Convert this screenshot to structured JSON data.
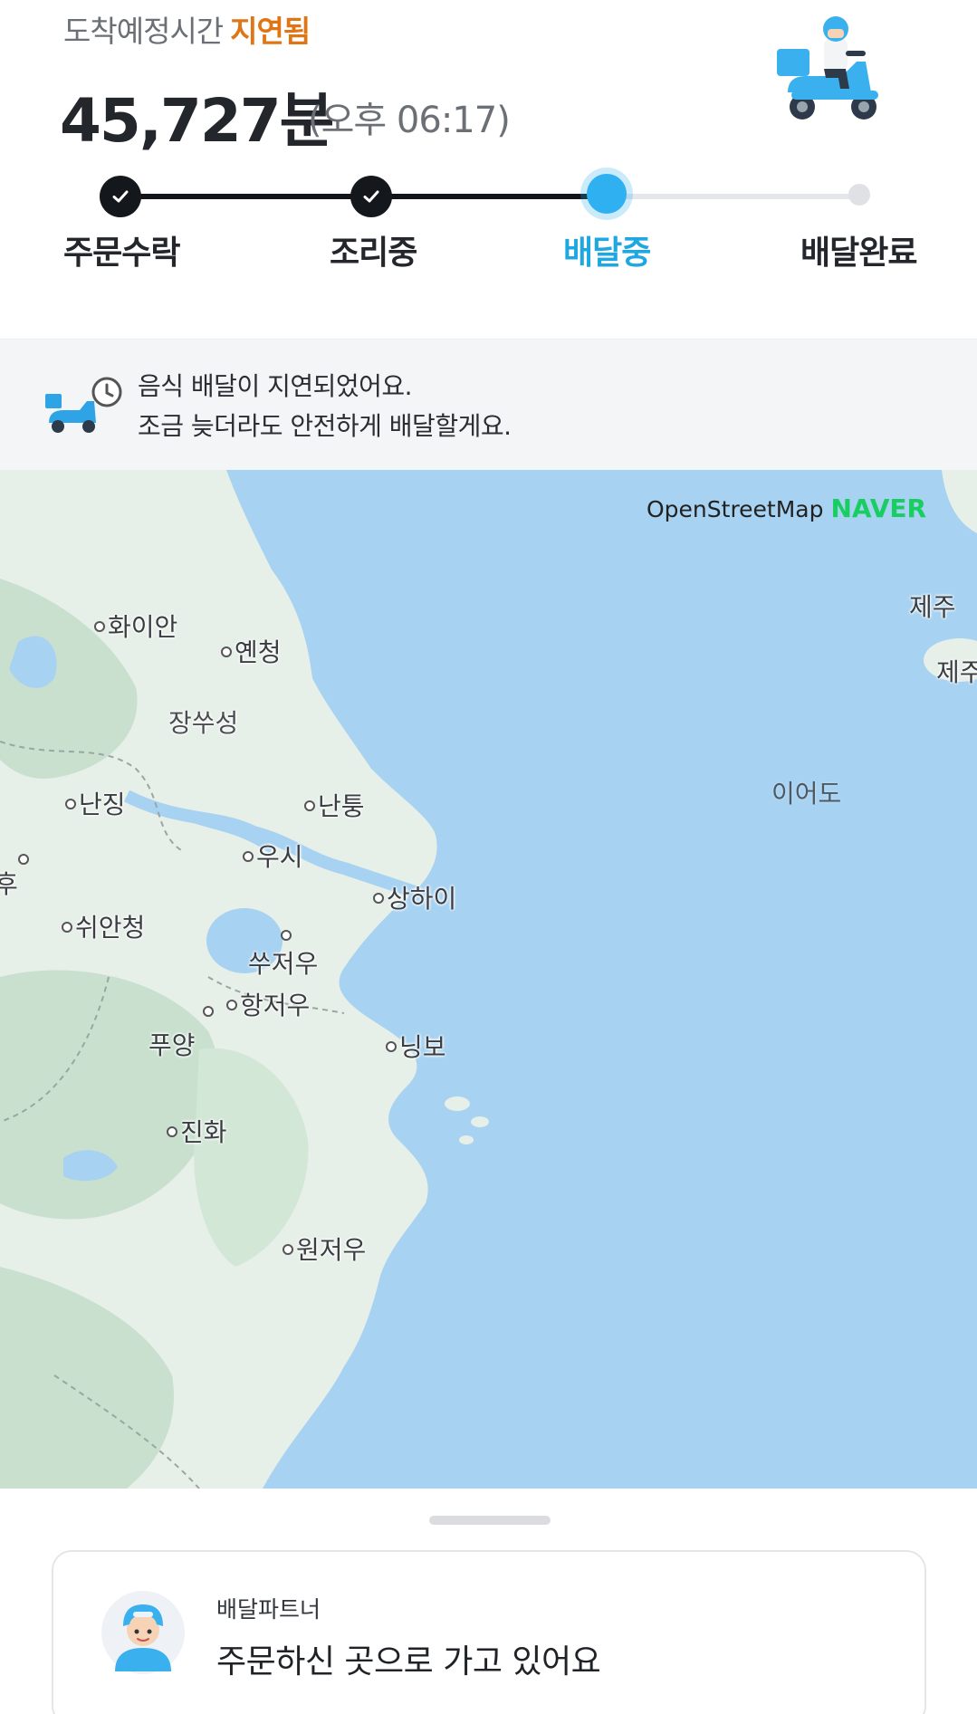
{
  "header": {
    "eta_label": "도착예정시간",
    "eta_status": "지연됨",
    "eta_minutes": "45,727분",
    "eta_clock": "(오후 06:17)",
    "rider_icon": "scooter-rider-illustration"
  },
  "progress": {
    "steps": [
      {
        "label": "주문수락",
        "state": "done"
      },
      {
        "label": "조리중",
        "state": "done"
      },
      {
        "label": "배달중",
        "state": "current"
      },
      {
        "label": "배달완료",
        "state": "pending"
      }
    ],
    "active_color": "#1ea7e0"
  },
  "notice": {
    "icon": "delivery-delay-icon",
    "line1": "음식 배달이 지연되었어요.",
    "line2": "조금 늦더라도 안전하게 배달할게요."
  },
  "map": {
    "attribution": "OpenStreetMap",
    "provider": "NAVER",
    "places": [
      "화이안",
      "옌청",
      "장쑤성",
      "난징",
      "난퉁",
      "우시",
      "쑤저우",
      "상하이",
      "쉬안청",
      "항저우",
      "푸양",
      "닝보",
      "진화",
      "원저우",
      "이어도",
      "제주",
      "제주",
      "후"
    ],
    "colors": {
      "sea": "#a7d2f1",
      "land": "#e6efe8",
      "forest": "#c9e0cf"
    }
  },
  "partner": {
    "label": "배달파트너",
    "status": "주문하신 곳으로 가고 있어요",
    "avatar_icon": "rider-avatar"
  }
}
